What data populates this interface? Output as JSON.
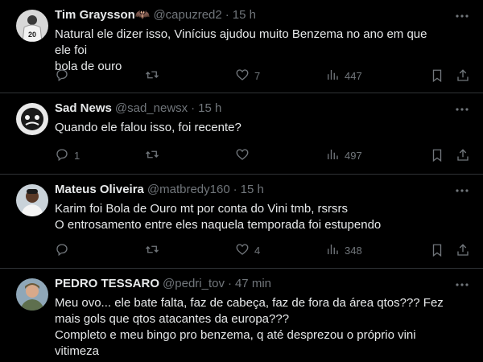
{
  "tweets": [
    {
      "name": "Tim Graysson🦇",
      "handle": "@capuzred2",
      "time": "15 h",
      "lines": [
        "Natural ele dizer isso, Vinícius ajudou muito Benzema no ano em que ele foi",
        "bola de ouro"
      ],
      "replies": "",
      "retweets": "",
      "likes": "7",
      "views": "447"
    },
    {
      "name": "Sad News",
      "handle": "@sad_newsx",
      "time": "15 h",
      "lines": [
        "Quando ele falou isso, foi recente?"
      ],
      "replies": "1",
      "retweets": "",
      "likes": "",
      "views": "497"
    },
    {
      "name": "Mateus Oliveira",
      "handle": "@matbredy160",
      "time": "15 h",
      "lines": [
        "Karim foi Bola de Ouro mt por conta do Vini tmb, rsrsrs",
        "O entrosamento entre eles naquela temporada foi estupendo"
      ],
      "replies": "",
      "retweets": "",
      "likes": "4",
      "views": "348"
    },
    {
      "name": "PEDRO TESSARO",
      "handle": "@pedri_tov",
      "time": "47 min",
      "lines": [
        "Meu ovo... ele bate falta, faz de cabeça, faz de fora da área qtos??? Fez",
        "mais gols que qtos atacantes da europa???",
        "Completo e meu bingo pro benzema, q até desprezou o próprio vini",
        "vitimeza"
      ]
    }
  ],
  "separator": "·",
  "colors": {
    "background": "#000000",
    "text": "#e7e9ea",
    "muted": "#71767b",
    "divider": "#2f3336"
  }
}
